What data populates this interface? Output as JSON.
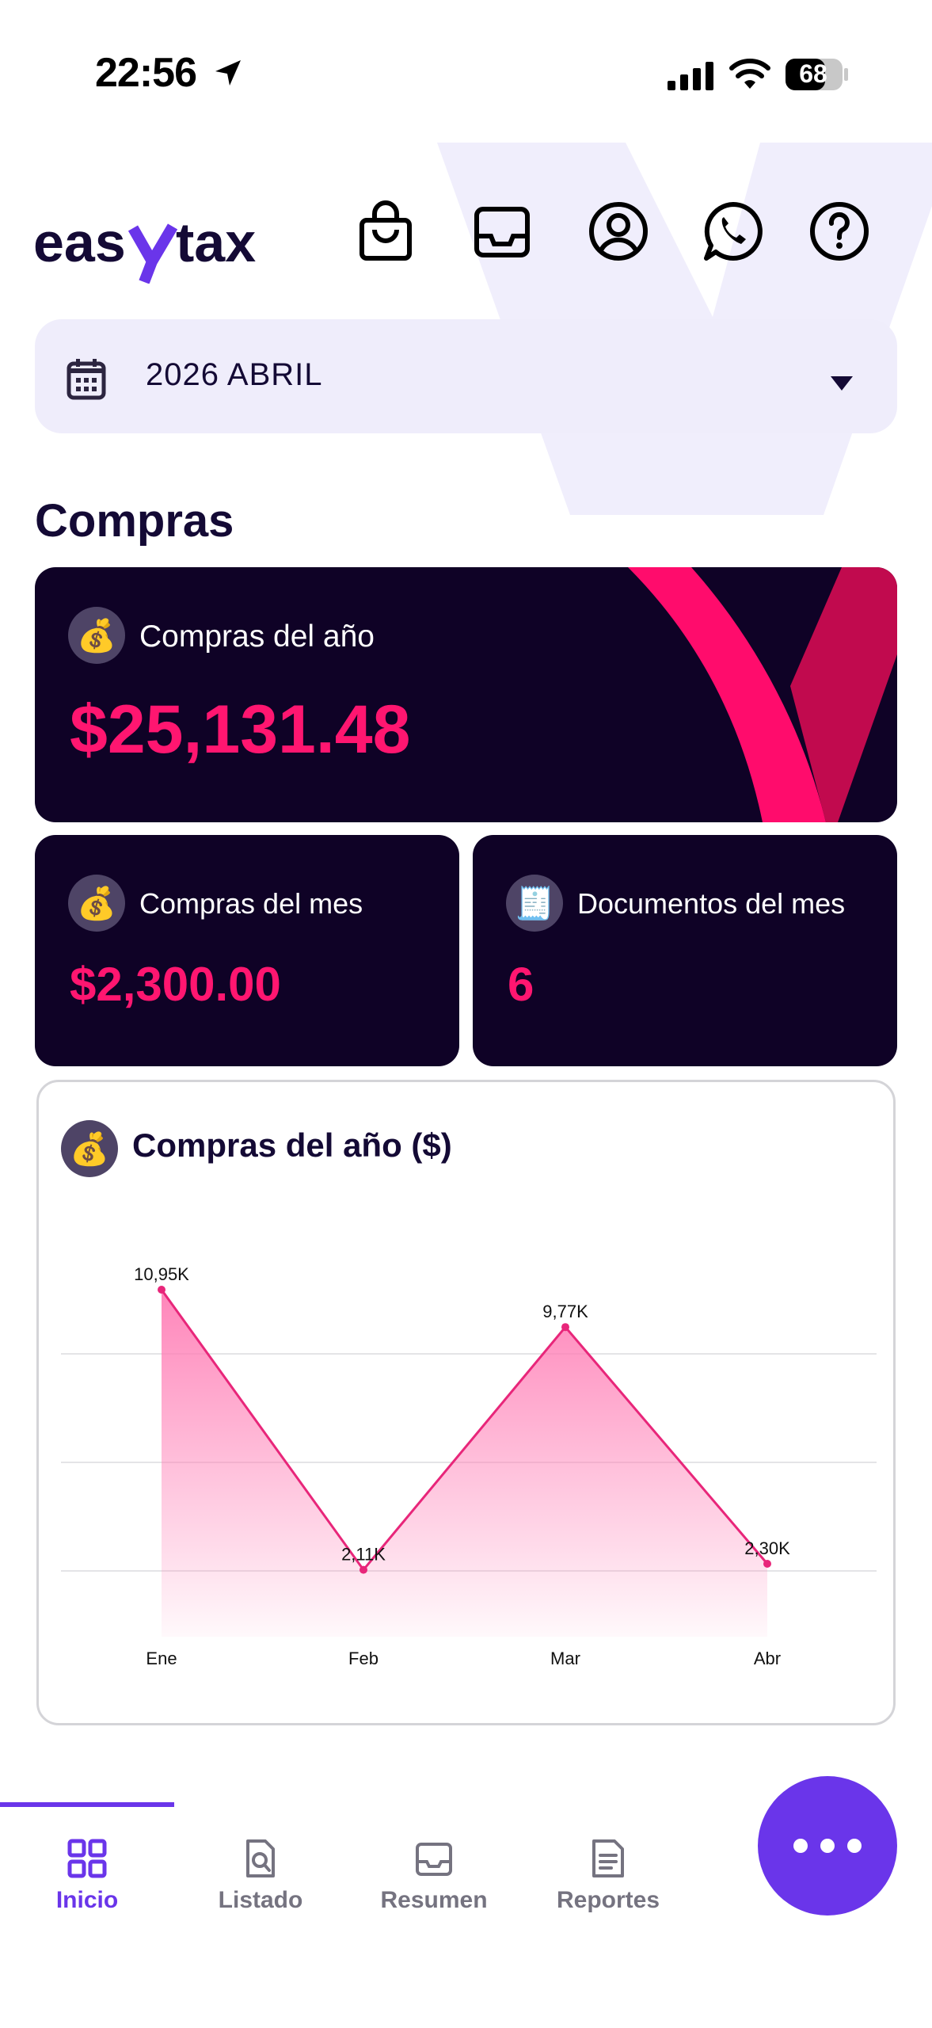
{
  "status_bar": {
    "time": "22:56",
    "battery": "68"
  },
  "header": {
    "logo_text": "easytax"
  },
  "date_selector": {
    "value": "2026 ABRIL"
  },
  "section": {
    "title": "Compras"
  },
  "cards": {
    "year": {
      "label": "Compras del año",
      "value": "$25,131.48"
    },
    "month": {
      "label": "Compras del mes",
      "value": "$2,300.00"
    },
    "docs": {
      "label": "Documentos del mes",
      "value": "6"
    }
  },
  "chart_card": {
    "title": "Compras del año ($)"
  },
  "chart_data": {
    "type": "area",
    "categories": [
      "Ene",
      "Feb",
      "Mar",
      "Abr"
    ],
    "series": [
      {
        "values": [
          10950,
          2110,
          9770,
          2300
        ]
      }
    ],
    "data_labels": [
      "10,95K",
      "2,11K",
      "9,77K",
      "2,30K"
    ],
    "grid": true,
    "colors": {
      "line": "#e8267a",
      "fill": "#ff7fb6"
    }
  },
  "tabs": [
    {
      "label": "Inicio",
      "icon": "grid-icon",
      "active": true
    },
    {
      "label": "Listado",
      "icon": "doc-search-icon",
      "active": false
    },
    {
      "label": "Resumen",
      "icon": "inbox-icon",
      "active": false
    },
    {
      "label": "Reportes",
      "icon": "report-icon",
      "active": false
    }
  ],
  "colors": {
    "accent": "#6a35ea",
    "pink": "#ff1670",
    "card_bg": "#0f0226"
  }
}
